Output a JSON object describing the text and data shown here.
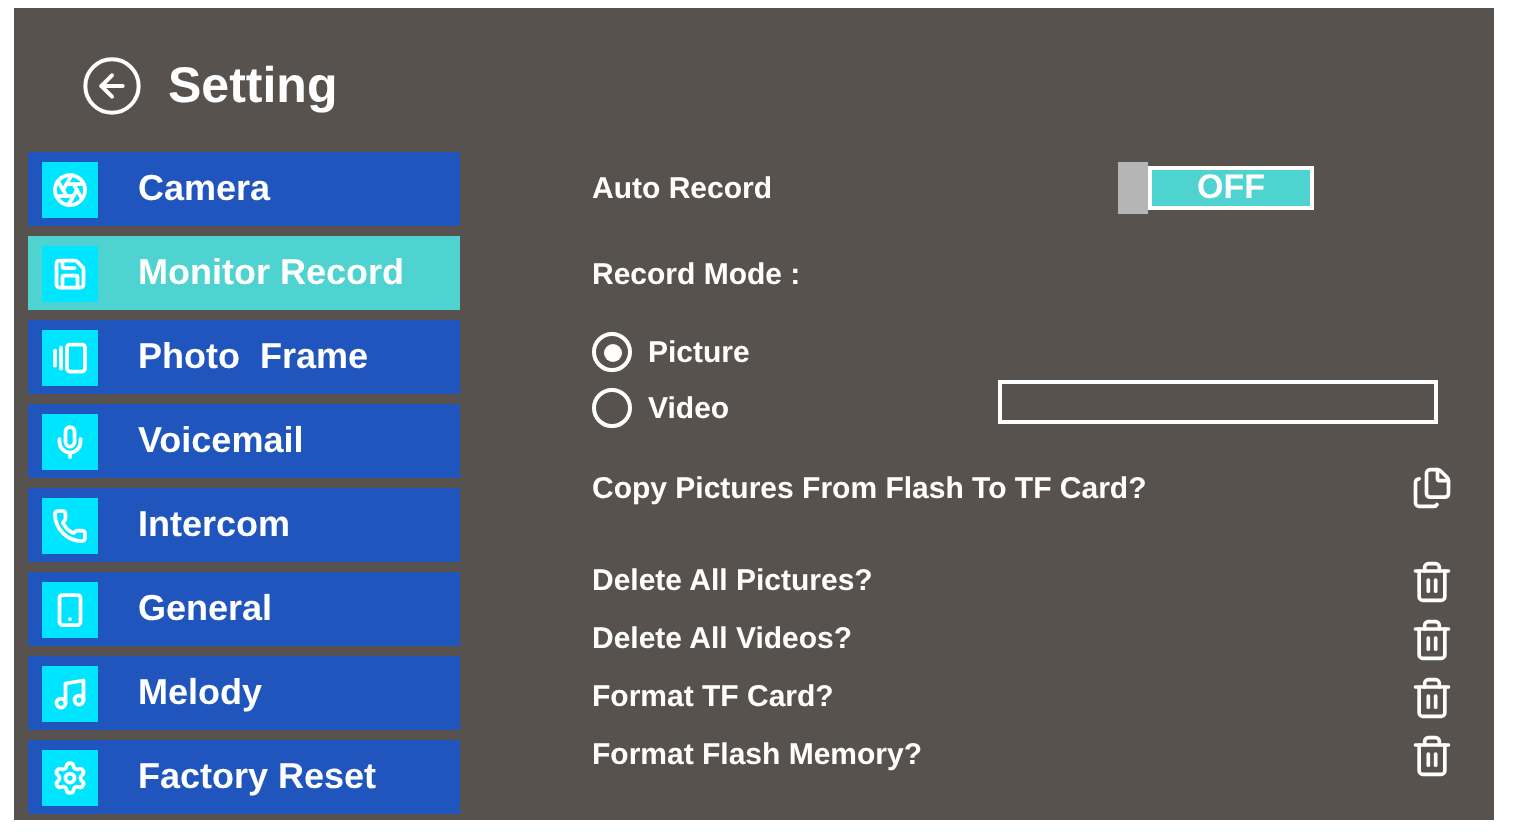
{
  "header": {
    "title": "Setting"
  },
  "menu": [
    {
      "label": "Camera",
      "selected": false
    },
    {
      "label": "Monitor Record",
      "selected": true
    },
    {
      "label": "Photo  Frame",
      "selected": false
    },
    {
      "label": "Voicemail",
      "selected": false
    },
    {
      "label": "Intercom",
      "selected": false
    },
    {
      "label": "General",
      "selected": false
    },
    {
      "label": "Melody",
      "selected": false
    },
    {
      "label": "Factory Reset",
      "selected": false
    }
  ],
  "auto_record": {
    "label": "Auto Record",
    "on": false,
    "state_text": "OFF"
  },
  "record_mode": {
    "label": "Record Mode :",
    "options": [
      {
        "label": "Picture",
        "selected": true
      },
      {
        "label": "Video",
        "selected": false
      }
    ]
  },
  "actions": [
    {
      "label": "Copy Pictures From Flash To TF Card?",
      "kind": "copy"
    },
    {
      "label": "Delete All Pictures?",
      "kind": "delete"
    },
    {
      "label": "Delete All Videos?",
      "kind": "delete"
    },
    {
      "label": "Format TF Card?",
      "kind": "delete"
    },
    {
      "label": "Format Flash Memory?",
      "kind": "delete"
    }
  ]
}
